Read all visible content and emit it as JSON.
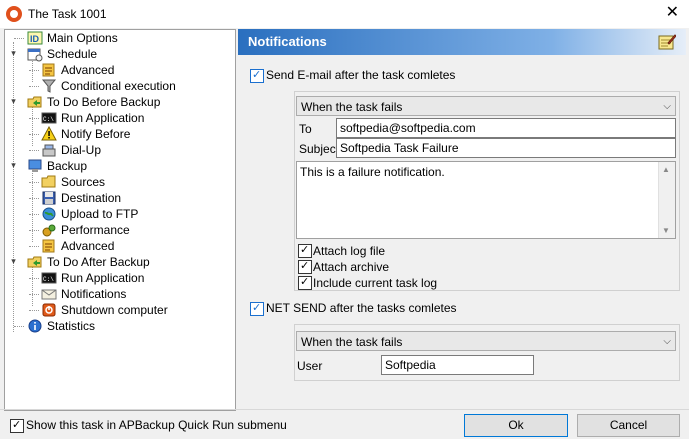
{
  "window": {
    "title": "The Task 1001"
  },
  "tree": {
    "items": [
      {
        "label": "Main Options",
        "icon": "id-card-icon"
      },
      {
        "label": "Schedule",
        "icon": "calendar-icon"
      },
      {
        "label": "Advanced",
        "icon": "advanced-icon"
      },
      {
        "label": "Conditional execution",
        "icon": "filter-funnel-icon"
      },
      {
        "label": "To Do Before Backup",
        "icon": "folder-arrow-icon"
      },
      {
        "label": "Run Application",
        "icon": "console-icon"
      },
      {
        "label": "Notify Before",
        "icon": "warning-icon"
      },
      {
        "label": "Dial-Up",
        "icon": "dialup-icon"
      },
      {
        "label": "Backup",
        "icon": "backup-computer-icon"
      },
      {
        "label": "Sources",
        "icon": "folder-icon"
      },
      {
        "label": "Destination",
        "icon": "floppy-disk-icon"
      },
      {
        "label": "Upload to FTP",
        "icon": "globe-upload-icon"
      },
      {
        "label": "Performance",
        "icon": "performance-icon"
      },
      {
        "label": "Advanced",
        "icon": "advanced-icon"
      },
      {
        "label": "To Do After Backup",
        "icon": "folder-arrow-icon"
      },
      {
        "label": "Run Application",
        "icon": "console-icon"
      },
      {
        "label": "Notifications",
        "icon": "envelope-icon"
      },
      {
        "label": "Shutdown computer",
        "icon": "shutdown-icon"
      },
      {
        "label": "Statistics",
        "icon": "info-icon"
      }
    ]
  },
  "panel": {
    "title": "Notifications",
    "email_checkbox_label": "Send E-mail after the task comletes",
    "email_condition": "When the task fails",
    "to_label": "To",
    "to_value": "softpedia@softpedia.com",
    "subject_label": "Subject",
    "subject_value": "Softpedia Task Failure",
    "message": "This is a failure notification.",
    "attach_log_label": "Attach log file",
    "attach_archive_label": "Attach archive",
    "include_log_label": "Include current task log",
    "netsend_checkbox_label": "NET SEND after the tasks comletes",
    "netsend_condition": "When the task fails",
    "user_label": "User",
    "user_value": "Softpedia"
  },
  "footer": {
    "quickrun_label": "Show this task in APBackup Quick Run submenu",
    "ok_label": "Ok",
    "cancel_label": "Cancel"
  },
  "colors": {
    "header_start": "#2a6fbf",
    "checkbox_accent": "#1a6fcf"
  }
}
